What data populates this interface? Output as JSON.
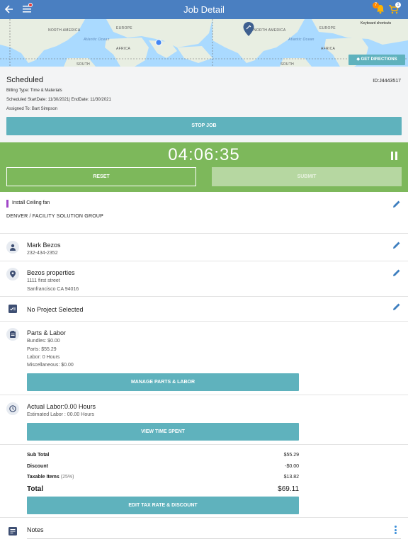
{
  "header": {
    "title": "Job Detail",
    "notification_count": "7",
    "cart_count": "1",
    "colors": {
      "bar": "#4a7fc1",
      "badge": "#ff8a00"
    }
  },
  "map": {
    "labels": {
      "north_america_left": "NORTH AMERICA",
      "europe_left": "EUROPE",
      "atlantic_left": "Atlantic Ocean",
      "africa": "AFRICA",
      "north_america_right": "NORTH AMERICA",
      "europe_right": "EUROPE",
      "atlantic_right": "Atlantic Ocean",
      "africa_right": "AFRICA",
      "south_left": "SOUTH",
      "south_right": "SOUTH"
    },
    "keyboard_shortcuts": "Keyboard shortcuts",
    "directions_label": "GET DIRECTIONS"
  },
  "job": {
    "status": "Scheduled",
    "id": "ID:J4443517",
    "billing_type": "Billing Type: Time & Materials",
    "dates": "Scheduled StartDate: 11/30/2021| EndDate: 11/30/2021",
    "assigned_to": "Assigned To: Bart Simpson",
    "stop_label": "STOP JOB"
  },
  "timer": {
    "time": "04:06:35",
    "reset_label": "RESET",
    "submit_label": "SUBMIT",
    "color": "#7db85b"
  },
  "task": {
    "title": "Install Ceiling fan",
    "organization": "DENVER / FACILITY SOLUTION GROUP"
  },
  "contact": {
    "name": "Mark Bezos",
    "phone": "232-434-2352"
  },
  "location": {
    "name": "Bezos properties",
    "street": "1111 first street",
    "city": "Sanfrancisco CA 94016"
  },
  "project": {
    "label": "No Project Selected"
  },
  "parts": {
    "title": "Parts & Labor",
    "bundles": "Bundles: $0.00",
    "parts": "Parts: $55.29",
    "labor": "Labor: 0 Hours",
    "misc": "Miscellaneous: $0.00",
    "button": "MANAGE PARTS & LABOR"
  },
  "labor": {
    "actual": "Actual Labor:0.00 Hours",
    "estimated": "Estimated Labor : 00.00 Hours",
    "button": "VIEW TIME SPENT"
  },
  "totals": {
    "subtotal_label": "Sub Total",
    "subtotal_value": "$55.29",
    "discount_label": "Discount",
    "discount_value": "-$0.00",
    "taxable_label": "Taxable Items",
    "taxable_pct": "(25%)",
    "taxable_value": "$13.82",
    "total_label": "Total",
    "total_value": "$69.11",
    "button": "EDIT TAX RATE & DISCOUNT"
  },
  "notes": {
    "label": "Notes"
  },
  "accent": "#5fb2bd"
}
